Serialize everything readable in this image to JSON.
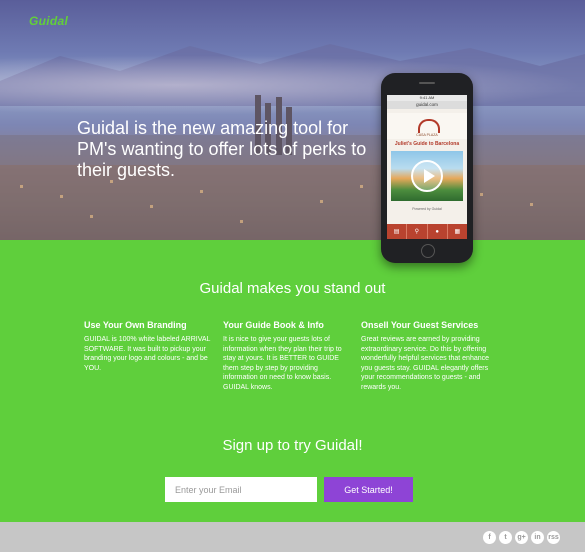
{
  "brand": {
    "logo": "Guidal"
  },
  "hero": {
    "headline": "Guidal is the new amazing tool for PM's wanting to offer lots of perks to their guests."
  },
  "phone": {
    "status": "9:41 AM",
    "url": "guidal.com",
    "logo_text": "CASA PLAZA",
    "title": "Juliet's Guide to Barcelona",
    "caption": "Powered by Guidal",
    "tabs": [
      "bed-icon",
      "search-icon",
      "car-icon",
      "calendar-icon"
    ]
  },
  "features": {
    "title": "Guidal makes you stand out",
    "columns": [
      {
        "heading": "Use Your Own Branding",
        "text": "GUIDAL is 100% white labeled ARRIVAL SOFTWARE. It was built to pickup your branding your logo and colours - and be YOU."
      },
      {
        "heading": "Your Guide Book & Info",
        "text": "It is nice to give your guests lots of information when they plan their trip to stay at yours. It is BETTER to GUIDE them step by step by providing information on need to know basis. GUIDAL knows."
      },
      {
        "heading": "Onsell Your Guest Services",
        "text": "Great reviews are earned by providing extraordinary service. Do this by offering wonderfully helpful services that enhance you guests stay. GUIDAL elegantly offers your recommendations to guests - and rewards you."
      }
    ]
  },
  "signup": {
    "title": "Sign up to try Guidal!",
    "email_placeholder": "Enter your Email",
    "email_value": "",
    "button_label": "Get Started!"
  },
  "footer": {
    "social": [
      "f",
      "t",
      "g+",
      "in",
      "rss"
    ]
  },
  "colors": {
    "green": "#5fcf3c",
    "purple": "#8e44d6",
    "footer": "#c6c6c6",
    "phone_accent": "#b9432f"
  }
}
